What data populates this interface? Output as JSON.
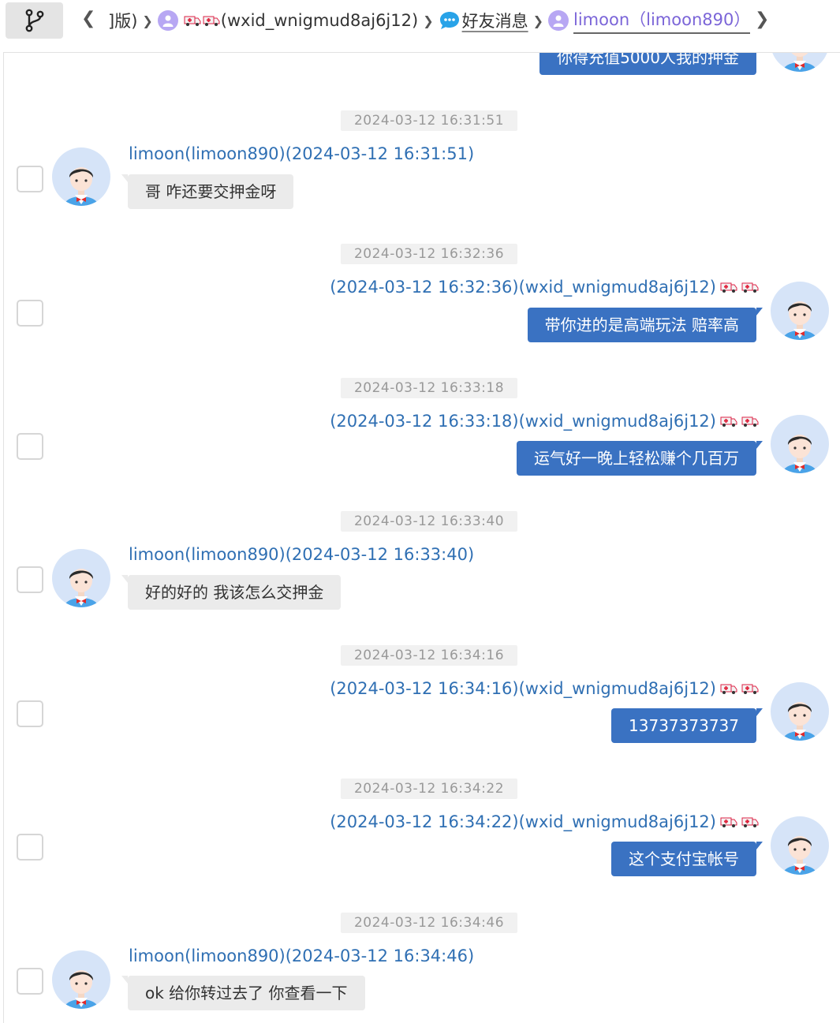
{
  "breadcrumb": {
    "partial": "]版)",
    "contact": "(wxid_wnigmud8aj6j12)",
    "category": "好友消息",
    "current": "limoon（limoon890）"
  },
  "messages": [
    {
      "side": "right",
      "text": "你得充值5000人我的押金",
      "clipped": true
    },
    {
      "timestamp": "2024-03-12 16:31:51",
      "side": "left",
      "sender": "limoon(limoon890)(2024-03-12 16:31:51)",
      "text": "哥  咋还要交押金呀"
    },
    {
      "timestamp": "2024-03-12 16:32:36",
      "side": "right",
      "sender": "(2024-03-12 16:32:36)(wxid_wnigmud8aj6j12)",
      "text": "带你进的是高端玩法 赔率高"
    },
    {
      "timestamp": "2024-03-12 16:33:18",
      "side": "right",
      "sender": "(2024-03-12 16:33:18)(wxid_wnigmud8aj6j12)",
      "text": "运气好一晚上轻松赚个几百万"
    },
    {
      "timestamp": "2024-03-12 16:33:40",
      "side": "left",
      "sender": "limoon(limoon890)(2024-03-12 16:33:40)",
      "text": "好的好的 我该怎么交押金"
    },
    {
      "timestamp": "2024-03-12 16:34:16",
      "side": "right",
      "sender": "(2024-03-12 16:34:16)(wxid_wnigmud8aj6j12)",
      "text": "13737373737"
    },
    {
      "timestamp": "2024-03-12 16:34:22",
      "side": "right",
      "sender": "(2024-03-12 16:34:22)(wxid_wnigmud8aj6j12)",
      "text": "这个支付宝帐号"
    },
    {
      "timestamp": "2024-03-12 16:34:46",
      "side": "left",
      "sender": "limoon(limoon890)(2024-03-12 16:34:46)",
      "text": "ok  给你转过去了 你查看一下"
    }
  ],
  "colors": {
    "accent": "#3a72c2",
    "sender": "#2f6fb3",
    "active_crumb": "#7b65d8"
  },
  "icons": [
    "branch-icon",
    "back-icon",
    "forward-icon",
    "user-icon",
    "ambulance-icon",
    "chat-bubble-icon",
    "avatar-icon"
  ]
}
